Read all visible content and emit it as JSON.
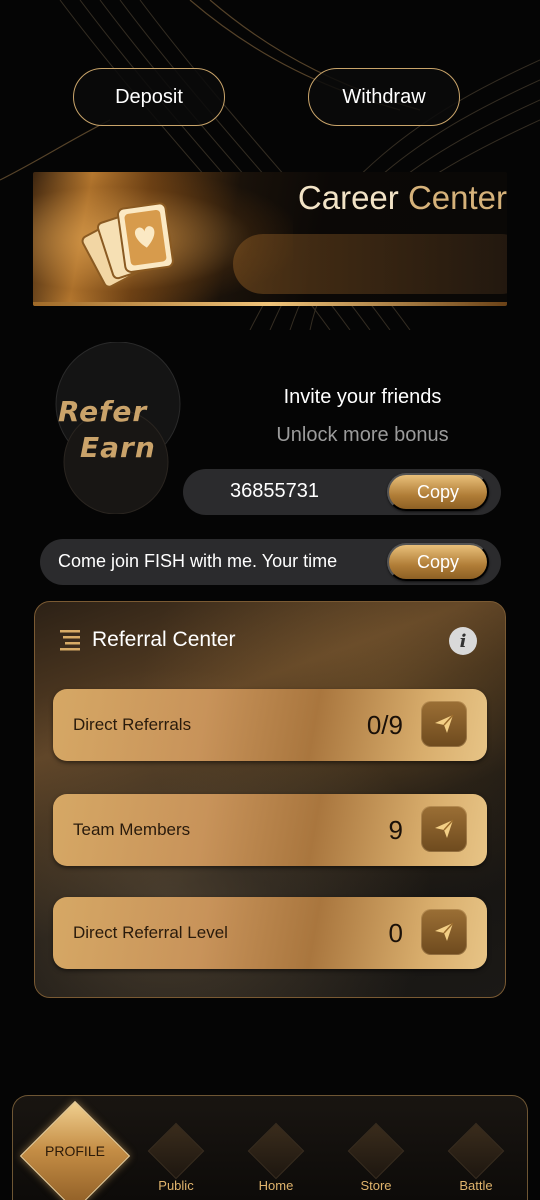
{
  "header": {
    "deposit_label": "Deposit",
    "withdraw_label": "Withdraw"
  },
  "banner": {
    "title_part1": "Career",
    "title_part2": "Center",
    "icon": "playing-cards-heart-icon"
  },
  "refer": {
    "logo_line1": "Refer",
    "logo_line2": "Earn",
    "title": "Invite your friends",
    "subtitle": "Unlock more bonus",
    "code": "36855731",
    "copy_label": "Copy",
    "message": "Come join FISH with me. Your time",
    "message_copy_label": "Copy"
  },
  "referral_center": {
    "title": "Referral Center",
    "info_glyph": "i",
    "items": [
      {
        "label": "Direct Referrals",
        "value": "0/9"
      },
      {
        "label": "Team Members",
        "value": "9"
      },
      {
        "label": "Direct Referral Level",
        "value": "0"
      }
    ]
  },
  "nav": {
    "items": [
      {
        "label": "PROFILE",
        "active": true
      },
      {
        "label": "Public"
      },
      {
        "label": "Home"
      },
      {
        "label": "Store"
      },
      {
        "label": "Battle"
      }
    ]
  },
  "colors": {
    "gold": "#c9a46a",
    "background": "#050505",
    "card": "#2b2b2d"
  }
}
